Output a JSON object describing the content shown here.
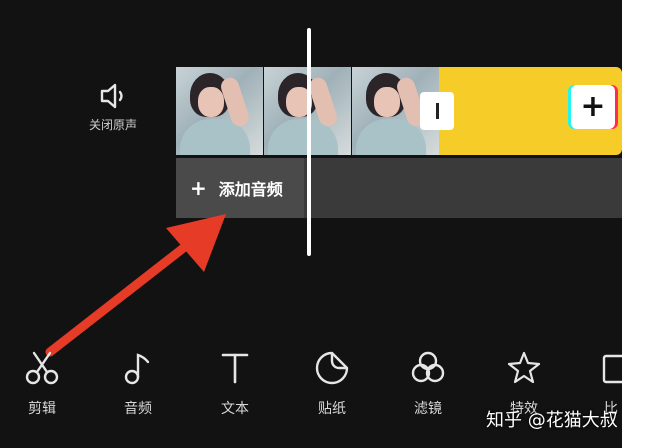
{
  "mute": {
    "label": "关闭原声",
    "icon": "speaker-icon"
  },
  "timeline": {
    "clips": [
      "video-clip",
      "video-clip",
      "video-clip"
    ],
    "add_audio_label": "添加音频",
    "add_audio_plus": "+",
    "add_clip_symbol": "+",
    "colors": {
      "clip_yellow": "#f6cc28",
      "audio_track": "#3a3a3a",
      "arrow": "#e53b27"
    }
  },
  "toolbar": {
    "items": [
      {
        "label": "剪辑",
        "icon": "scissors-icon"
      },
      {
        "label": "音频",
        "icon": "music-note-icon"
      },
      {
        "label": "文本",
        "icon": "text-icon"
      },
      {
        "label": "贴纸",
        "icon": "sticker-icon"
      },
      {
        "label": "滤镜",
        "icon": "filter-icon"
      },
      {
        "label": "特效",
        "icon": "effects-star-icon"
      },
      {
        "label": "比",
        "icon": "ratio-icon"
      }
    ]
  },
  "watermark": "知乎 @花猫大叔"
}
